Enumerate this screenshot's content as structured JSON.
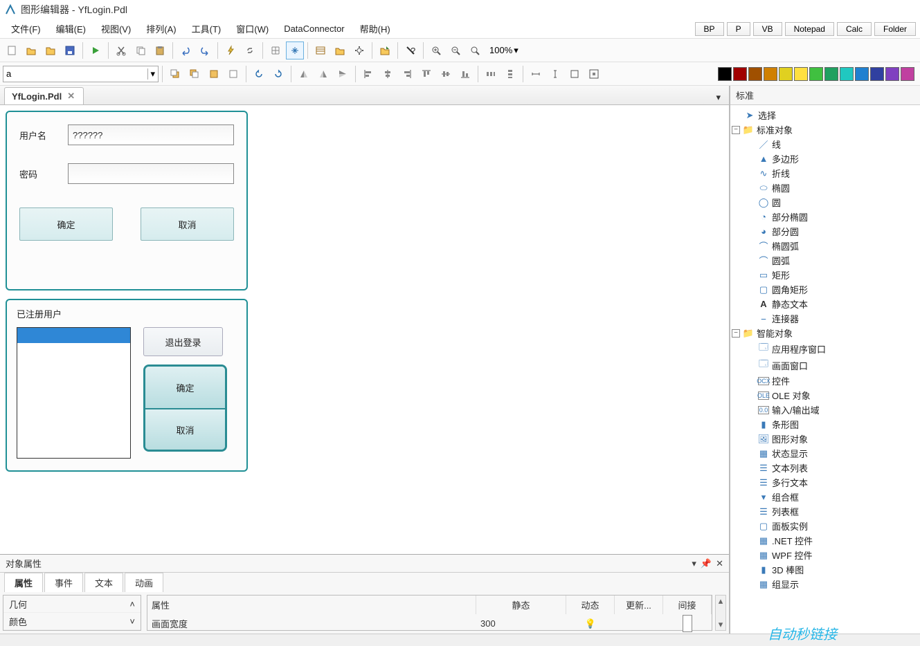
{
  "title": "图形编辑器 - YfLogin.Pdl",
  "menubar": [
    "文件(F)",
    "编辑(E)",
    "视图(V)",
    "排列(A)",
    "工具(T)",
    "窗口(W)",
    "DataConnector",
    "帮助(H)"
  ],
  "ext_buttons": [
    "BP",
    "P",
    "VB",
    "Notepad",
    "Calc",
    "Folder"
  ],
  "toolbar": {
    "zoom": "100%"
  },
  "font_combo": "a",
  "colors": [
    "#000000",
    "#808080",
    "#a00000",
    "#d08000",
    "#e0c020",
    "#40a040",
    "#20c8a0",
    "#2080d0",
    "#3040a0",
    "#8040c0",
    "#c040a0"
  ],
  "colors2": [
    "#ff2020",
    "#ff8020",
    "#ffe040",
    "#60e060",
    "#40e0c0",
    "#40a0ff",
    "#5060ff",
    "#a060ff",
    "#ff60e0",
    "#ff80a0"
  ],
  "tab": {
    "label": "YfLogin.Pdl"
  },
  "login": {
    "user_label": "用户名",
    "user_value": "??????",
    "pass_label": "密码",
    "pass_value": "",
    "ok": "确定",
    "cancel": "取消"
  },
  "registered": {
    "title": "已注册用户",
    "logout": "退出登录",
    "ok": "确定",
    "cancel": "取消"
  },
  "prop_panel": {
    "title": "对象属性",
    "tabs": [
      "属性",
      "事件",
      "文本",
      "动画"
    ],
    "left_rows": [
      "几何",
      "颜色"
    ],
    "hdr": {
      "attr": "属性",
      "static": "静态",
      "dynamic": "动态",
      "update": "更新...",
      "indirect": "间接"
    },
    "row": {
      "attr": "画面宽度",
      "static": "300"
    }
  },
  "right": {
    "title": "标准",
    "select": "选择",
    "std_group": "标准对象",
    "std_items": [
      "线",
      "多边形",
      "折线",
      "椭圆",
      "圆",
      "部分椭圆",
      "部分圆",
      "椭圆弧",
      "圆弧",
      "矩形",
      "圆角矩形",
      "静态文本",
      "连接器"
    ],
    "smart_group": "智能对象",
    "smart_items": [
      "应用程序窗口",
      "画面窗口",
      "控件",
      "OLE 对象",
      "输入/输出域",
      "条形图",
      "图形对象",
      "状态显示",
      "文本列表",
      "多行文本",
      "组合框",
      "列表框",
      "面板实例",
      ".NET 控件",
      "WPF 控件",
      "3D 棒图",
      "组显示"
    ]
  },
  "statusbar": {
    "watermark": "自动秒链接"
  }
}
